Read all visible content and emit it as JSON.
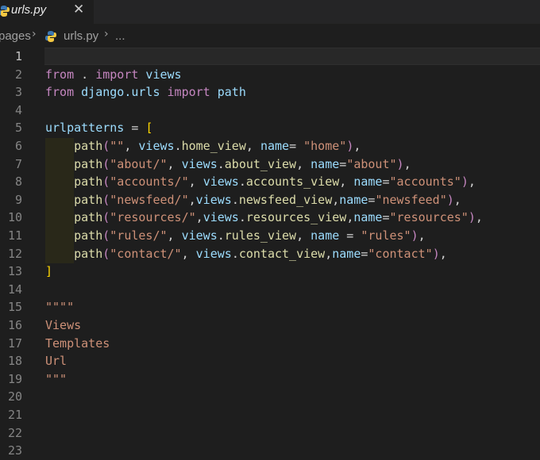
{
  "tab": {
    "filename": "urls.py",
    "close": "✕"
  },
  "breadcrumb": {
    "parent": "pages",
    "file": "urls.py",
    "more": "..."
  },
  "gutter": [
    "1",
    "2",
    "3",
    "4",
    "5",
    "6",
    "7",
    "8",
    "9",
    "10",
    "11",
    "12",
    "13",
    "14",
    "15",
    "16",
    "17",
    "18",
    "19",
    "20",
    "21",
    "22",
    "23"
  ],
  "code": {
    "l2": {
      "from": "from",
      "dot": " . ",
      "import": "import",
      "views": " views"
    },
    "l3": {
      "from": "from",
      "mod": " django.urls ",
      "import": "import",
      "path": " path"
    },
    "l5": {
      "name": "urlpatterns",
      "eq": " = ",
      "open": "["
    },
    "routes": [
      {
        "path": "path",
        "q": "\"\"",
        "views": "views",
        "attr": "home_view",
        "kw": "name",
        "eq": "= ",
        "val": "\"home\"",
        "sep1": ", ",
        "sep2": ", "
      },
      {
        "path": "path",
        "q": "\"about/\"",
        "views": "views",
        "attr": "about_view",
        "kw": "name",
        "eq": "=",
        "val": "\"about\"",
        "sep1": ", ",
        "sep2": ", "
      },
      {
        "path": "path",
        "q": "\"accounts/\"",
        "views": "views",
        "attr": "accounts_view",
        "kw": "name",
        "eq": "=",
        "val": "\"accounts\"",
        "sep1": ", ",
        "sep2": ", "
      },
      {
        "path": "path",
        "q": "\"newsfeed/\"",
        "views": "views",
        "attr": "newsfeed_view",
        "kw": "name",
        "eq": "=",
        "val": "\"newsfeed\"",
        "sep1": ",",
        "sep2": ","
      },
      {
        "path": "path",
        "q": "\"resources/\"",
        "views": "views",
        "attr": "resources_view",
        "kw": "name",
        "eq": "=",
        "val": "\"resources\"",
        "sep1": ",",
        "sep2": ","
      },
      {
        "path": "path",
        "q": "\"rules/\"",
        "views": "views",
        "attr": "rules_view",
        "kw": "name",
        "eq": " = ",
        "val": "\"rules\"",
        "sep1": ", ",
        "sep2": ", "
      },
      {
        "path": "path",
        "q": "\"contact/\"",
        "views": "views",
        "attr": "contact_view",
        "kw": "name",
        "eq": "=",
        "val": "\"contact\"",
        "sep1": ", ",
        "sep2": ","
      }
    ],
    "l13": "]",
    "doc": [
      "\"\"\"\"",
      "Views",
      "Templates",
      "Url",
      "\"\"\""
    ]
  },
  "colors": {
    "keyword": "#c586c0",
    "variable": "#9cdcfe",
    "function": "#dcdcaa",
    "string": "#ce9178",
    "bracket": "#ffd700"
  },
  "icons": {
    "file": "python-icon"
  }
}
